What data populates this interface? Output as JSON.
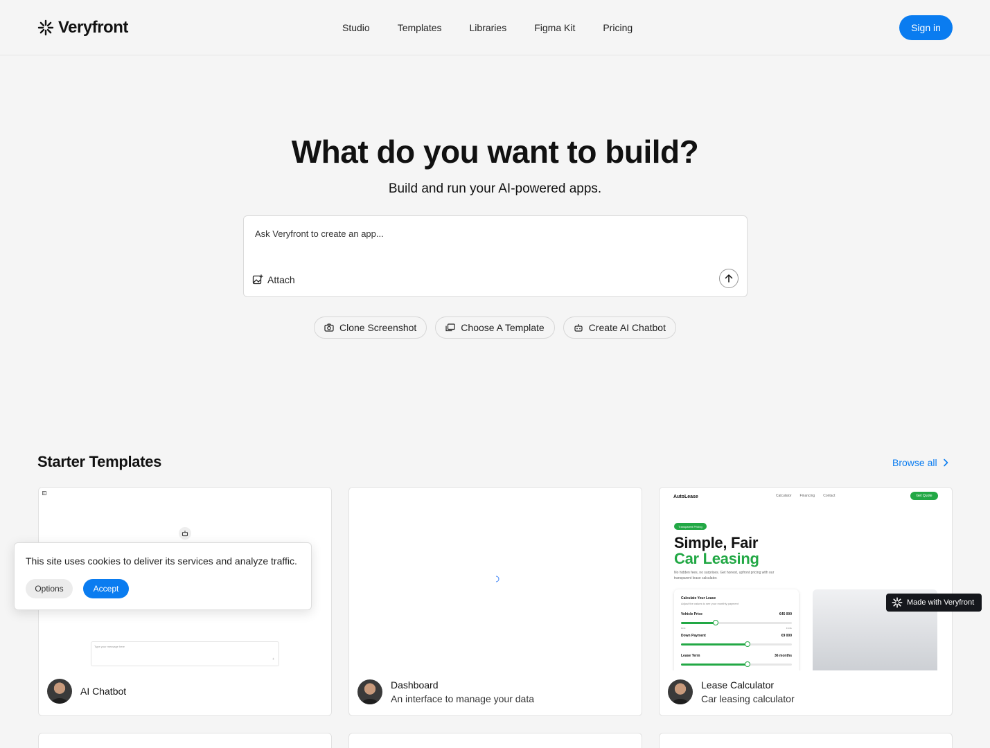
{
  "brand": {
    "name": "Veryfront",
    "logo_icon": "sparkle-asterisk-icon"
  },
  "nav": {
    "items": [
      "Studio",
      "Templates",
      "Libraries",
      "Figma Kit",
      "Pricing"
    ],
    "signin": "Sign in"
  },
  "hero": {
    "title": "What do you want to build?",
    "subtitle": "Build and run your AI-powered apps.",
    "prompt_placeholder": "Ask Veryfront to create an app...",
    "attach_label": "Attach",
    "chips": [
      {
        "label": "Clone Screenshot",
        "icon": "camera-icon"
      },
      {
        "label": "Choose A Template",
        "icon": "template-icon"
      },
      {
        "label": "Create AI Chatbot",
        "icon": "robot-icon"
      }
    ]
  },
  "templates": {
    "title": "Starter Templates",
    "browse": "Browse all",
    "cards": [
      {
        "title": "AI Chatbot",
        "description": "",
        "preview_input": "Type your message here"
      },
      {
        "title": "Dashboard",
        "description": "An interface to manage your data"
      },
      {
        "title": "Lease Calculator",
        "description": "Car leasing calculator"
      }
    ],
    "lease_preview": {
      "brand": "AutoLease",
      "links": [
        "Calculator",
        "Financing",
        "Contact"
      ],
      "cta": "Get Quote",
      "badge": "Transparent Pricing",
      "heading_1": "Simple, Fair",
      "heading_2": "Car Leasing",
      "paragraph": "No hidden fees, no surprises. Get honest, upfront pricing with our transparent lease calculator.",
      "calc_title": "Calculate Your Lease",
      "calc_sub": "Adjust the values to see your monthly payment",
      "rows": [
        {
          "label": "Vehicle Price",
          "value": "€45 000",
          "min": "€20k",
          "max": "€100k",
          "fraction": 0.31
        },
        {
          "label": "Down Payment",
          "value": "€9 000",
          "fraction": 0.6
        },
        {
          "label": "Lease Term",
          "value": "36 months",
          "fraction": 0.6
        }
      ],
      "accent": "#22a845"
    }
  },
  "cookie": {
    "text": "This site uses cookies to deliver its services and analyze traffic.",
    "options": "Options",
    "accept": "Accept"
  },
  "made_with": "Made with Veryfront",
  "colors": {
    "primary": "#0a7cf0",
    "background": "#f5f5f5",
    "text": "#111111"
  }
}
